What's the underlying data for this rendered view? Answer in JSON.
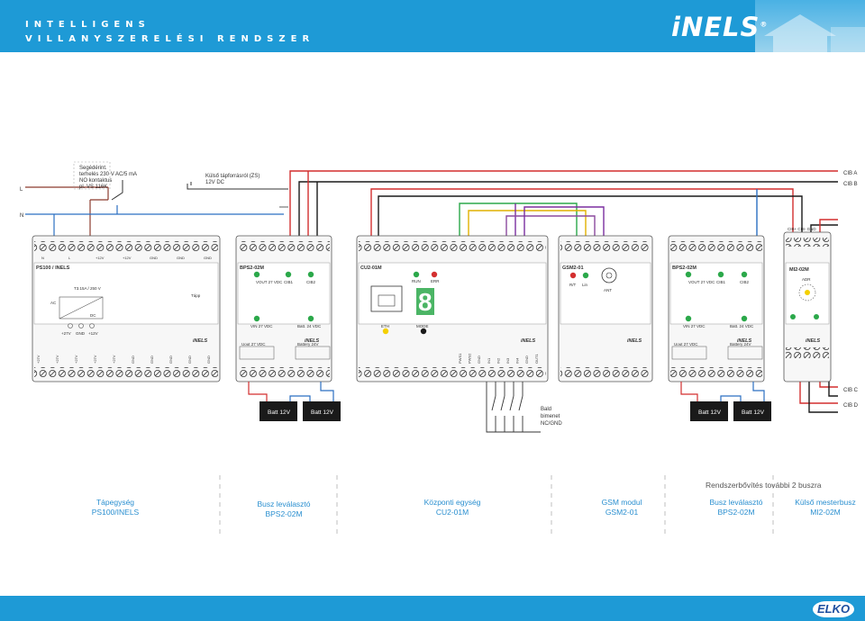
{
  "header": {
    "brand_line1": "INTELLIGENS",
    "brand_line2": "VILLANYSZERELÉSI RENDSZER",
    "logo": "iNELS"
  },
  "labels": {
    "aux_contact": [
      "Segédérint.",
      "terhelés 230 V AC/5 mA",
      "NO kontaktus",
      "pl. VS 116K"
    ],
    "ext_supply": [
      "Külső tápforrásról (ZS)",
      "12V DC"
    ],
    "line_L": "L",
    "line_N": "N",
    "cib_a": "CIB A",
    "cib_b": "CIB B",
    "cib_c": "CIB C",
    "cib_d": "CIB D",
    "inputs_note": [
      "Bald",
      "bimenet",
      "NC/GND"
    ],
    "batt": "Batt 12V"
  },
  "modules": {
    "ps100": {
      "title": "PS100 / INELS",
      "fuse": "T3.15A / 250 V",
      "tap": "Tápp",
      "ac": "AC",
      "dc": "DC",
      "terminals_top": [
        "N",
        "L",
        "+12V",
        "+12V",
        "GND",
        "GND",
        "GND"
      ],
      "terminals_bottom": [
        "+27V",
        "+27V",
        "+27V",
        "+27V",
        "+27V",
        "GND",
        "GND",
        "GND",
        "GND",
        "GND"
      ],
      "out_labels": [
        "+27V",
        "GND",
        "+12V"
      ],
      "brand": "iNELS"
    },
    "bps_left": {
      "title": "BPS2-02M",
      "vout": "VOUT 27 VDC",
      "cib1": "CIB1",
      "cib2": "CIB2",
      "vin": "VIN 27 VDC",
      "batt": "Batt. 24 VDC",
      "uout": "Uout 27 VDC",
      "battery": "Battery 24V",
      "brand": "iNELS"
    },
    "cu2": {
      "title": "CU2-01M",
      "run": "RUN",
      "err": "ERR",
      "digit": "8",
      "eth": "ETH",
      "mode": "MODE",
      "inputs": [
        "PWS1",
        "PWS2",
        "GND",
        "IN1",
        "IN2",
        "IN3",
        "IN4",
        "GND",
        "OUT1"
      ],
      "brand": "iNELS"
    },
    "gsm": {
      "title": "GSM2-01",
      "rt": "R/T",
      "lin": "Lin",
      "ant": "ANT",
      "brand": "iNELS"
    },
    "bps_right": {
      "title": "BPS2-02M",
      "vout": "VOUT 27 VDC",
      "cib1": "CIB1",
      "cib2": "CIB2",
      "vin": "VIN 27 VDC",
      "batt": "Batt. 24 VDC",
      "uout": "Uout 27 VDC",
      "battery": "Battery 24V",
      "brand": "iNELS"
    },
    "mi2": {
      "title": "MI2-02M",
      "addr": "ADR",
      "brand": "iNELS",
      "top": "CIB+ CIB- GND"
    }
  },
  "captions": [
    {
      "line1": "Tápegység",
      "line2": "PS100/INELS"
    },
    {
      "line1": "Busz leválasztó",
      "line2": "BPS2-02M"
    },
    {
      "line1": "Központi egység",
      "line2": "CU2-01M"
    },
    {
      "line1": "GSM modul",
      "line2": "GSM2-01"
    },
    {
      "line1": "Busz leválasztó",
      "line2": "BPS2-02M"
    },
    {
      "line1": "Külső mesterbusz",
      "line2": "MI2-02M"
    }
  ],
  "extension_title": "Rendszerbővítés további 2 buszra",
  "footer": {
    "logo": "ELKO"
  },
  "colors": {
    "blue": "#1e9ad6",
    "caption": "#2a8fd0"
  }
}
